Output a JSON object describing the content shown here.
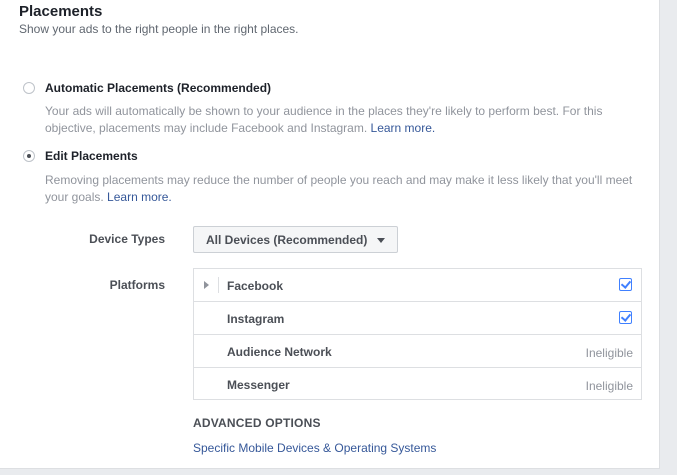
{
  "header": {
    "title": "Placements",
    "subtitle": "Show your ads to the right people in the right places."
  },
  "options": {
    "automatic": {
      "label": "Automatic Placements (Recommended)",
      "selected": false,
      "description": "Your ads will automatically be shown to your audience in the places they're likely to perform best. For this objective, placements may include Facebook and Instagram.",
      "link": "Learn more."
    },
    "edit": {
      "label": "Edit Placements",
      "selected": true,
      "description": "Removing placements may reduce the number of people you reach and may make it less likely that you'll meet your goals.",
      "link": "Learn more."
    }
  },
  "device_types": {
    "label": "Device Types",
    "value": "All Devices (Recommended)"
  },
  "platforms": {
    "label": "Platforms",
    "items": [
      {
        "name": "Facebook",
        "checked": true,
        "status": ""
      },
      {
        "name": "Instagram",
        "checked": true,
        "status": ""
      },
      {
        "name": "Audience Network",
        "checked": false,
        "status": "Ineligible"
      },
      {
        "name": "Messenger",
        "checked": false,
        "status": "Ineligible"
      }
    ]
  },
  "advanced": {
    "heading": "ADVANCED OPTIONS",
    "link": "Specific Mobile Devices & Operating Systems"
  },
  "colors": {
    "link": "#365899",
    "checkbox": "#4080ff",
    "background": "#e9ebee"
  }
}
